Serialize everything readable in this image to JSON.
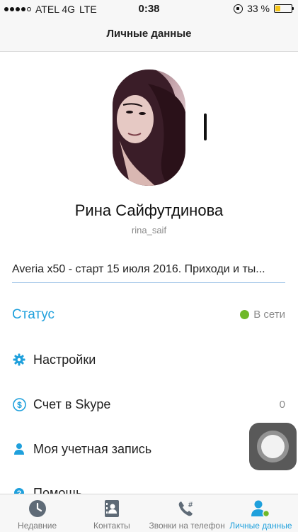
{
  "status_bar": {
    "carrier": "ATEL 4G",
    "network": "LTE",
    "time": "0:38",
    "battery": "33 %",
    "battery_level": 0.33,
    "signal_bars_filled": 4,
    "signal_bars_total": 5
  },
  "nav": {
    "title": "Личные данные"
  },
  "profile": {
    "name": "Рина Сайфутдинова",
    "login": "rina_saif",
    "mood": "Averia x50 - старт 15 июля 2016. Приходи и ты..."
  },
  "status": {
    "label": "Статус",
    "value": "В сети",
    "color": "#6fb829"
  },
  "menu": {
    "settings": {
      "label": "Настройки",
      "icon": "gear-icon"
    },
    "skype_credit": {
      "label": "Счет в Skype",
      "count": "0",
      "icon": "dollar-icon"
    },
    "account": {
      "label": "Моя учетная запись",
      "icon": "person-icon"
    },
    "help": {
      "label": "Помощь",
      "icon": "question-icon"
    }
  },
  "tabs": [
    {
      "label": "Недавние",
      "icon": "clock-icon",
      "active": false
    },
    {
      "label": "Контакты",
      "icon": "contacts-icon",
      "active": false
    },
    {
      "label": "Звонки на телефон",
      "icon": "phone-dial-icon",
      "active": false
    },
    {
      "label": "Личные данные",
      "icon": "profile-icon",
      "active": true
    }
  ],
  "colors": {
    "accent": "#1fa0dc",
    "online": "#6fb829",
    "battery": "#f5c518"
  }
}
